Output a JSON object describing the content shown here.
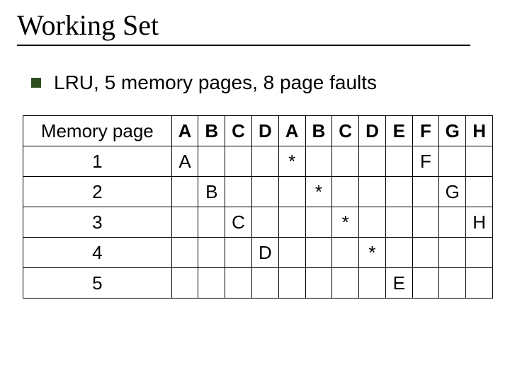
{
  "title": "Working Set",
  "bullet": "LRU, 5 memory pages, 8 page faults",
  "table": {
    "header_label": "Memory page",
    "columns": [
      "A",
      "B",
      "C",
      "D",
      "A",
      "B",
      "C",
      "D",
      "E",
      "F",
      "G",
      "H"
    ],
    "rows": [
      {
        "label": "1",
        "cells": [
          "A",
          "",
          "",
          "",
          "*",
          "",
          "",
          "",
          "",
          "F",
          "",
          ""
        ]
      },
      {
        "label": "2",
        "cells": [
          "",
          "B",
          "",
          "",
          "",
          "*",
          "",
          "",
          "",
          "",
          "G",
          ""
        ]
      },
      {
        "label": "3",
        "cells": [
          "",
          "",
          "C",
          "",
          "",
          "",
          "*",
          "",
          "",
          "",
          "",
          "H"
        ]
      },
      {
        "label": "4",
        "cells": [
          "",
          "",
          "",
          "D",
          "",
          "",
          "",
          "*",
          "",
          "",
          "",
          ""
        ]
      },
      {
        "label": "5",
        "cells": [
          "",
          "",
          "",
          "",
          "",
          "",
          "",
          "",
          "E",
          "",
          "",
          ""
        ]
      }
    ]
  }
}
